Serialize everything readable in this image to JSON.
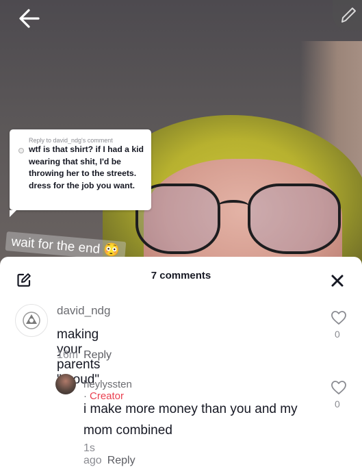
{
  "video": {
    "reply_card": {
      "label": "Reply to david_ndg's comment",
      "text": "wtf is that shirt? if I had a kid wearing that shit, I'd be throwing her to the streets. dress for the job you want."
    },
    "caption": "wait for the end 😳"
  },
  "toolbar": {
    "back_icon": "arrow-left-icon",
    "edit_icon": "pencil-icon"
  },
  "comments_panel": {
    "title": "7 comments",
    "comments": [
      {
        "username": "david_ndg",
        "text": "making your parents \"proud\"",
        "time": "16m",
        "reply_label": "Reply",
        "likes": "0"
      },
      {
        "username": "heylyssten",
        "separator": "·",
        "badge": "Creator",
        "text": "i make more money than you and my mom combined",
        "time": "1s ago",
        "reply_label": "Reply",
        "likes": "0"
      }
    ]
  },
  "colors": {
    "creator_badge": "#ea3f4f",
    "text_primary": "#161823",
    "text_secondary": "#8a8b91"
  }
}
